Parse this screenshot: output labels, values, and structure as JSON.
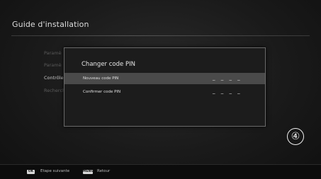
{
  "header": {
    "title": "Guide d'installation"
  },
  "background_menu": {
    "items": [
      {
        "label": "Paramè"
      },
      {
        "label": "Paramè"
      },
      {
        "label": "Contrôle"
      },
      {
        "label": "Recherch"
      }
    ]
  },
  "dialog": {
    "title": "Changer code PIN",
    "fields": [
      {
        "label": "Nouveau code PIN",
        "value": "_ _ _ _"
      },
      {
        "label": "Confirmer code PIN",
        "value": "_ _ _ _"
      }
    ]
  },
  "step_marker": "④",
  "footer": {
    "ok_key": "OK",
    "ok_label": "Etape suivante",
    "menu_key": "MENU",
    "menu_label": "Retour"
  },
  "colors": {
    "background": "#1a1a1a",
    "dialog": "#1c1c1c",
    "selected_row": "#4a4a4a",
    "text": "#e8e8e8"
  }
}
